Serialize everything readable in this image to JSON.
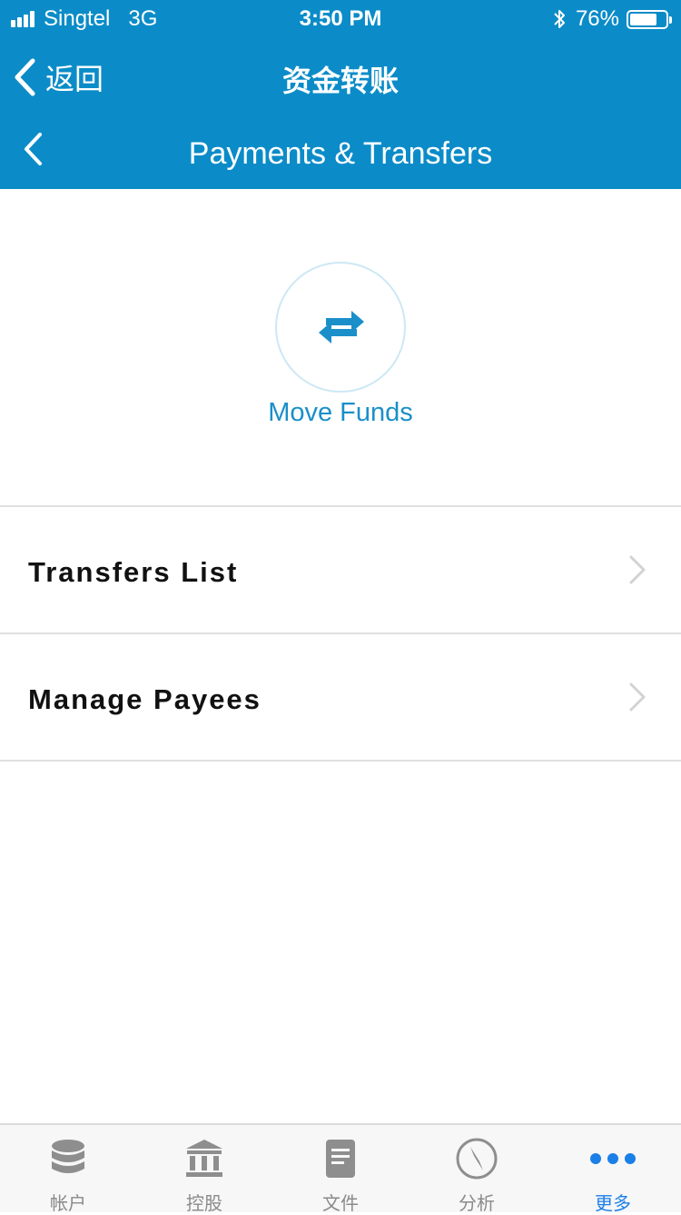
{
  "status_bar": {
    "carrier": "Singtel",
    "network": "3G",
    "time": "3:50 PM",
    "battery": "76%",
    "battery_level": 0.76
  },
  "nav_outer": {
    "back_label": "返回",
    "title": "资金转账"
  },
  "nav_inner": {
    "title": "Payments & Transfers"
  },
  "move_funds": {
    "label": "Move Funds",
    "icon": "swap-arrows-icon",
    "color": "#1a8fc9"
  },
  "menu": {
    "items": [
      {
        "label": "Transfers List"
      },
      {
        "label": "Manage Payees"
      }
    ]
  },
  "tabbar": {
    "active_color": "#1b7fe8",
    "tabs": [
      {
        "label": "帐户",
        "icon": "database-icon"
      },
      {
        "label": "控股",
        "icon": "bank-icon"
      },
      {
        "label": "文件",
        "icon": "document-icon"
      },
      {
        "label": "分析",
        "icon": "compass-icon"
      },
      {
        "label": "更多",
        "icon": "more-dots-icon",
        "active": true
      }
    ]
  },
  "theme": {
    "header_bg": "#0b8cc8"
  }
}
